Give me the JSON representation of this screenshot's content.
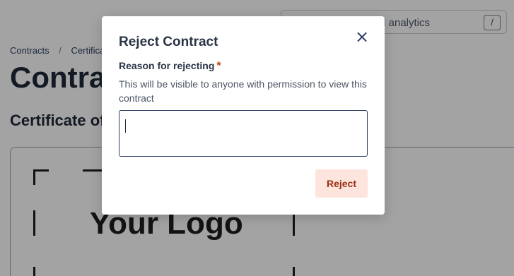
{
  "search": {
    "visible_text": "d analytics",
    "shortcut": "/"
  },
  "breadcrumb": {
    "items": [
      "Contracts",
      "Certificat"
    ],
    "separator": "/"
  },
  "page": {
    "title": "Contrac",
    "section_title": "Certificate of",
    "logo_text": "Your Logo"
  },
  "modal": {
    "title": "Reject Contract",
    "close_label": "×",
    "field_label": "Reason for rejecting",
    "required_mark": "*",
    "help_text": "This will be visible to anyone with permission to view this contract",
    "input_value": "",
    "reject_label": "Reject"
  },
  "colors": {
    "overlay": "#5c5c5c",
    "accent": "#2d3d63",
    "required": "#c2410c",
    "reject_bg": "#fde4dd",
    "reject_text": "#9a2e12"
  }
}
